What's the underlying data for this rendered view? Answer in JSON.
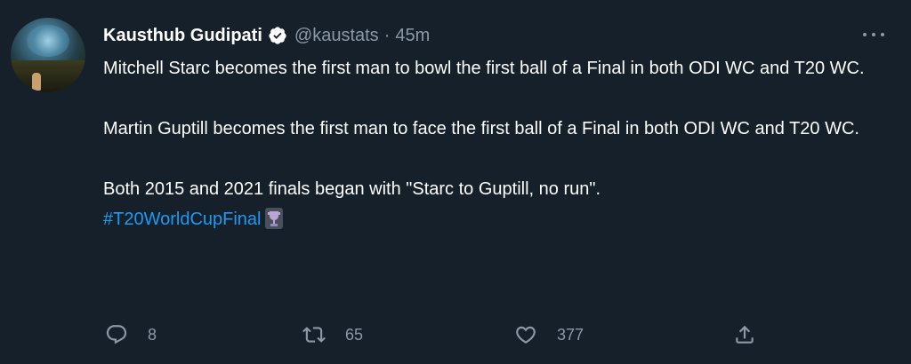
{
  "author": {
    "name": "Kausthub Gudipati",
    "handle": "@kaustats",
    "separator": "·",
    "time": "45m"
  },
  "tweet": {
    "line1": "Mitchell Starc becomes the first man to bowl the first ball of a Final in both ODI WC and T20 WC.",
    "line2": "Martin Guptill becomes the first man to face the first ball of a Final in both ODI WC and T20 WC.",
    "line3": "Both 2015 and 2021 finals began with \"Starc to Guptill, no run\".",
    "hashtag": "#T20WorldCupFinal"
  },
  "actions": {
    "replies": "8",
    "retweets": "65",
    "likes": "377"
  },
  "icons": {
    "verified": "verified-badge-icon",
    "more": "more-options-icon",
    "reply": "reply-icon",
    "retweet": "retweet-icon",
    "like": "heart-icon",
    "share": "share-icon",
    "trophy": "trophy-emoji-icon"
  },
  "colors": {
    "background": "#15202b",
    "text": "#ffffff",
    "secondary": "#8b98a5",
    "link": "#1d9bf0"
  }
}
